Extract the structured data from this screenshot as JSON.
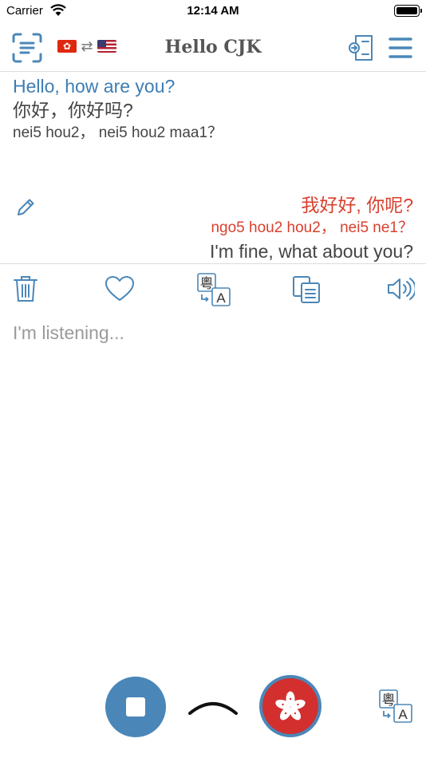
{
  "status_bar": {
    "carrier": "Carrier",
    "time": "12:14 AM",
    "battery_level": 1.0
  },
  "nav": {
    "title": "Hello CJK",
    "swap_symbol": "⇄",
    "icons": {
      "scan": "scan-text-icon",
      "from_flag": "hong-kong-flag-icon",
      "to_flag": "us-flag-icon",
      "history": "import-history-icon",
      "menu": "hamburger-menu-icon"
    }
  },
  "conversation": {
    "left": {
      "source": "Hello, how are you?",
      "translation": "你好，你好吗?",
      "romanization": "nei5 hou2， nei5 hou2 maa1？"
    },
    "right": {
      "source": "我好好, 你呢?",
      "romanization": "ngo5 hou2 hou2， nei5 ne1？",
      "translation": "I'm fine, what about you?"
    }
  },
  "actions": {
    "icons": [
      "trash-icon",
      "heart-icon",
      "cantonese-translate-icon",
      "copy-icon",
      "speaker-icon"
    ]
  },
  "listening": {
    "placeholder": "I'm listening..."
  },
  "controls": {
    "icons": [
      "stop-icon",
      "chevron-up-icon",
      "hong-kong-flag-icon",
      "cantonese-translate-icon"
    ],
    "cantonese_glyph": "粵",
    "latin_glyph": "A"
  },
  "colors": {
    "accent": "#4a87b8",
    "english_text": "#3d7db4",
    "chinese_reply": "#d9402e",
    "placeholder": "#9a9a9a"
  }
}
